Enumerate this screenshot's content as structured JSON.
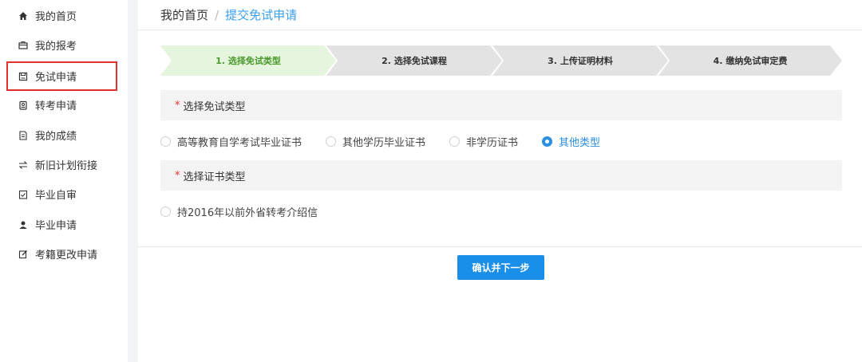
{
  "sidebar": {
    "items": [
      {
        "label": "我的首页",
        "icon": "home-icon"
      },
      {
        "label": "我的报考",
        "icon": "briefcase-icon"
      },
      {
        "label": "免试申请",
        "icon": "save-icon"
      },
      {
        "label": "转考申请",
        "icon": "badge-icon"
      },
      {
        "label": "我的成绩",
        "icon": "document-icon"
      },
      {
        "label": "新旧计划衔接",
        "icon": "swap-icon"
      },
      {
        "label": "毕业自审",
        "icon": "check-file-icon"
      },
      {
        "label": "毕业申请",
        "icon": "user-icon"
      },
      {
        "label": "考籍更改申请",
        "icon": "edit-icon"
      }
    ]
  },
  "breadcrumb": {
    "home": "我的首页",
    "sep": "/",
    "current": "提交免试申请"
  },
  "steps": [
    {
      "label": "1. 选择免试类型",
      "active": true
    },
    {
      "label": "2. 选择免试课程",
      "active": false
    },
    {
      "label": "3. 上传证明材料",
      "active": false
    },
    {
      "label": "4. 缴纳免试审定费",
      "active": false
    }
  ],
  "section1": {
    "required_mark": "*",
    "title": "选择免试类型"
  },
  "exempt_types": [
    {
      "label": "高等教育自学考试毕业证书",
      "checked": false
    },
    {
      "label": "其他学历毕业证书",
      "checked": false
    },
    {
      "label": "非学历证书",
      "checked": false
    },
    {
      "label": "其他类型",
      "checked": true
    }
  ],
  "section2": {
    "required_mark": "*",
    "title": "选择证书类型"
  },
  "cert_types": [
    {
      "label": "持2016年以前外省转考介绍信",
      "checked": false
    }
  ],
  "confirm_button": "确认并下一步",
  "colors": {
    "accent": "#1a8fea",
    "active_step": "#e6f5de",
    "inactive_step": "#e3e3e3",
    "highlight": "#e0322f"
  }
}
